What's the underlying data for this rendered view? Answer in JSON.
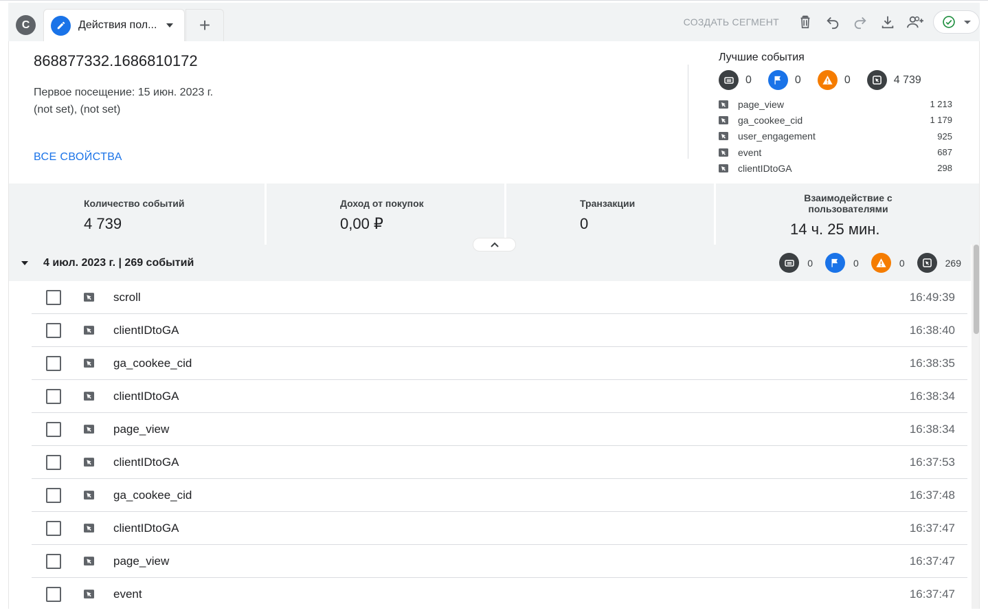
{
  "tabs": {
    "segment_letter": "C",
    "active_label": "Действия пол...",
    "add_label": "+"
  },
  "toolbar": {
    "create_segment": "СОЗДАТЬ СЕГМЕНТ",
    "icons": [
      "delete-icon",
      "undo-icon",
      "redo-icon",
      "download-icon",
      "share-user-icon",
      "status-check-icon"
    ]
  },
  "user": {
    "id": "868877332.1686810172",
    "first_visit": "Первое посещение: 15 июн. 2023 г.",
    "geo": "(not set), (not set)",
    "all_properties": "ВСЕ СВОЙСТВА"
  },
  "best_events": {
    "title": "Лучшие события",
    "counts": {
      "conversions": "0",
      "flags": "0",
      "errors": "0",
      "events": "4 739"
    },
    "items": [
      {
        "name": "page_view",
        "value": "1 213"
      },
      {
        "name": "ga_cookee_cid",
        "value": "1 179"
      },
      {
        "name": "user_engagement",
        "value": "925"
      },
      {
        "name": "event",
        "value": "687"
      },
      {
        "name": "clientIDtoGA",
        "value": "298"
      }
    ]
  },
  "metrics": [
    {
      "label": "Количество событий",
      "value": "4 739"
    },
    {
      "label": "Доход от покупок",
      "value": "0,00 ₽"
    },
    {
      "label": "Транзакции",
      "value": "0"
    },
    {
      "label": "Взаимодействие с пользователями",
      "value": "14 ч. 25 мин."
    }
  ],
  "day": {
    "title": "4 июл. 2023 г. | 269 событий",
    "counts": {
      "conversions": "0",
      "flags": "0",
      "errors": "0",
      "events": "269"
    }
  },
  "events": [
    {
      "name": "scroll",
      "time": "16:49:39"
    },
    {
      "name": "clientIDtoGA",
      "time": "16:38:40"
    },
    {
      "name": "ga_cookee_cid",
      "time": "16:38:35"
    },
    {
      "name": "clientIDtoGA",
      "time": "16:38:34"
    },
    {
      "name": "page_view",
      "time": "16:38:34"
    },
    {
      "name": "clientIDtoGA",
      "time": "16:37:53"
    },
    {
      "name": "ga_cookee_cid",
      "time": "16:37:48"
    },
    {
      "name": "clientIDtoGA",
      "time": "16:37:47"
    },
    {
      "name": "page_view",
      "time": "16:37:47"
    },
    {
      "name": "event",
      "time": "16:37:47"
    }
  ],
  "colors": {
    "accent": "#1a73e8",
    "warning": "#f57c00",
    "dark": "#3c4043",
    "status_green": "#1e8e3e"
  }
}
